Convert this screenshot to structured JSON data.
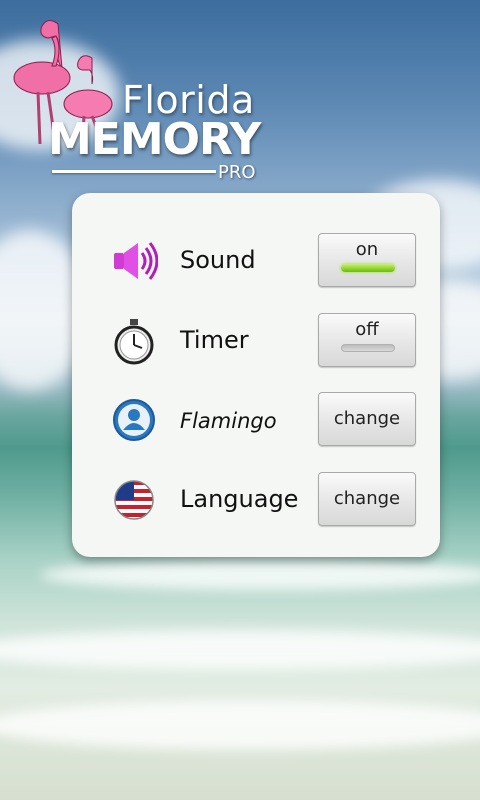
{
  "logo": {
    "line1": "Florida",
    "line2": "MEMORY",
    "line3": "PRO"
  },
  "settings": [
    {
      "id": "sound",
      "icon": "speaker-icon",
      "label": "Sound",
      "button": "on",
      "state": "on"
    },
    {
      "id": "timer",
      "icon": "stopwatch-icon",
      "label": "Timer",
      "button": "off",
      "state": "off"
    },
    {
      "id": "player",
      "icon": "user-icon",
      "label": "Flamingo",
      "button": "change"
    },
    {
      "id": "language",
      "icon": "us-flag-icon",
      "label": "Language",
      "button": "change"
    }
  ],
  "colors": {
    "indicator_on": "#8cd42a",
    "speaker": "#d23ad6",
    "flamingo": "#f06fa6"
  }
}
